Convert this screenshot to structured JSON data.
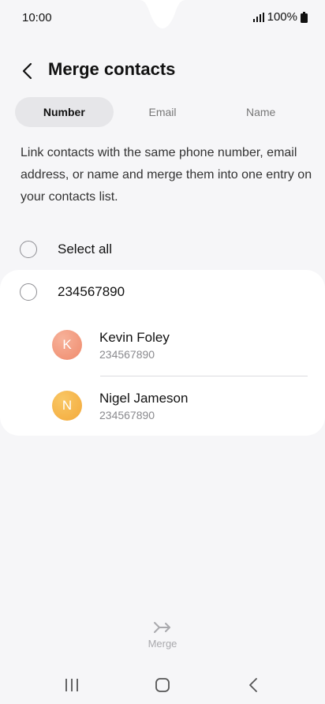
{
  "status_bar": {
    "time": "10:00",
    "battery": "100%",
    "signal_icon": "signal-icon",
    "battery_icon": "battery-icon"
  },
  "header": {
    "title": "Merge contacts",
    "back_icon": "back-arrow-icon"
  },
  "tabs": [
    {
      "label": "Number",
      "active": true
    },
    {
      "label": "Email",
      "active": false
    },
    {
      "label": "Name",
      "active": false
    }
  ],
  "description": "Link contacts with the same phone number, email address, or name and merge them into one entry on your contacts list.",
  "select_all": {
    "label": "Select all",
    "checked": false
  },
  "groups": [
    {
      "label": "234567890",
      "checked": false,
      "contacts": [
        {
          "initial": "K",
          "name": "Kevin Foley",
          "number": "234567890",
          "avatar_color": "#f29a7e"
        },
        {
          "initial": "N",
          "name": "Nigel Jameson",
          "number": "234567890",
          "avatar_color": "#f6b547"
        }
      ]
    }
  ],
  "bottom_action": {
    "label": "Merge",
    "icon": "merge-icon",
    "enabled": false
  },
  "nav_bar": {
    "recents_icon": "recents-icon",
    "home_icon": "home-icon",
    "back_icon": "nav-back-icon"
  },
  "colors": {
    "background": "#f6f6f8",
    "card": "#ffffff",
    "active_tab": "#e6e6e9",
    "disabled": "#a9a9ad"
  }
}
